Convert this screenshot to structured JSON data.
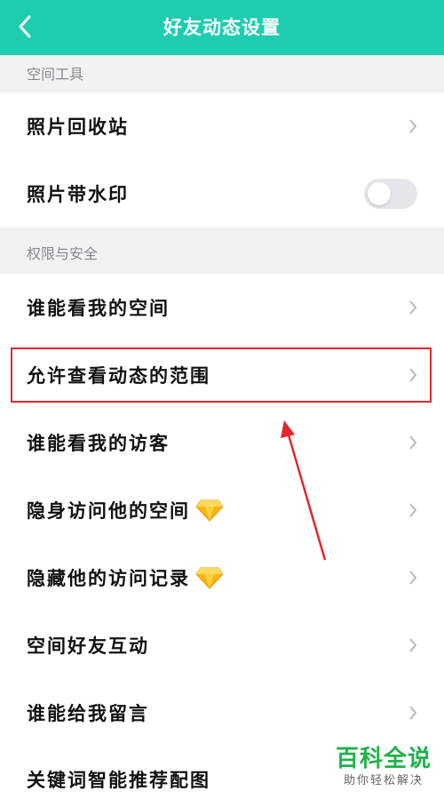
{
  "header": {
    "title": "好友动态设置",
    "back_icon": "chevron-left-icon",
    "bg_color": "#1ecdb0"
  },
  "sections": [
    {
      "title": "空间工具",
      "items": [
        {
          "label": "照片回收站",
          "control": "chevron"
        },
        {
          "label": "照片带水印",
          "control": "toggle",
          "toggle_on": false
        }
      ]
    },
    {
      "title": "权限与安全",
      "items": [
        {
          "label": "谁能看我的空间",
          "control": "chevron"
        },
        {
          "label": "允许查看动态的范围",
          "control": "chevron",
          "highlighted": true
        },
        {
          "label": "谁能看我的访客",
          "control": "chevron"
        },
        {
          "label": "隐身访问他的空间",
          "control": "chevron",
          "badge_icon": "diamond-icon"
        },
        {
          "label": "隐藏他的访问记录",
          "control": "chevron",
          "badge_icon": "diamond-icon"
        },
        {
          "label": "空间好友互动",
          "control": "chevron"
        },
        {
          "label": "谁能给我留言",
          "control": "chevron"
        },
        {
          "label": "关键词智能推荐配图",
          "control": "chevron"
        }
      ]
    }
  ],
  "annotation": {
    "highlight_color": "#e0282e"
  },
  "watermark": {
    "title": "百科全说",
    "subtitle": "助你轻松解决",
    "color": "#22b14c"
  }
}
